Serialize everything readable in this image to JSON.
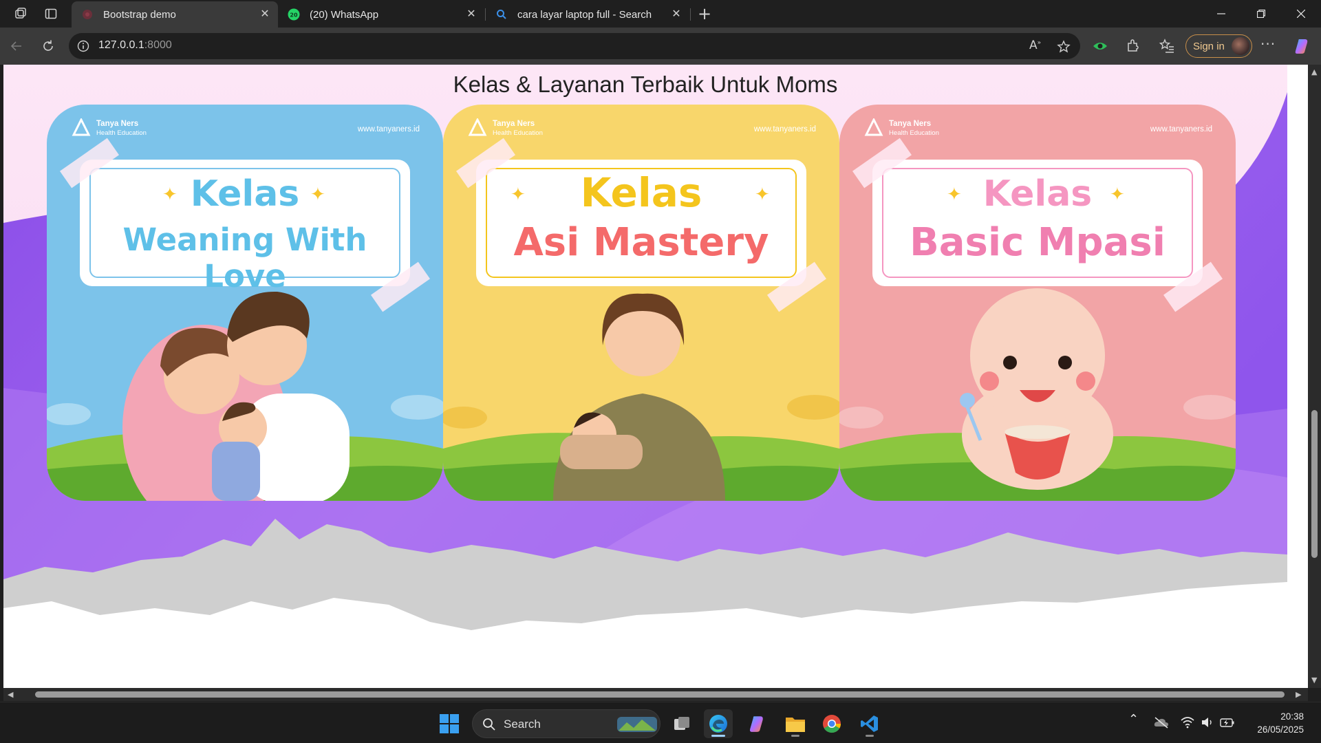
{
  "browser": {
    "tabs": [
      {
        "title": "Bootstrap demo",
        "active": true
      },
      {
        "title": "(20) WhatsApp",
        "badge": "20",
        "active": false
      },
      {
        "title": "cara layar laptop full - Search",
        "active": false
      }
    ],
    "url_host": "127.0.0.1",
    "url_port": ":8000",
    "sign_in_label": "Sign in"
  },
  "page": {
    "heading": "Kelas & Layanan Terbaik Untuk Moms",
    "cards": [
      {
        "brand": "Tanya Ners",
        "brand_sub": "Health Education",
        "site": "www.tanyaners.id",
        "kelas": "Kelas",
        "title": "Weaning With Love",
        "bg": "#7cc3ea",
        "kelas_color": "#5ec0e8",
        "title_color": "#5ec0e8"
      },
      {
        "brand": "Tanya Ners",
        "brand_sub": "Health Education",
        "site": "www.tanyaners.id",
        "kelas": "Kelas",
        "title": "Asi Mastery",
        "bg": "#f8d66b",
        "kelas_color": "#f4c51d",
        "title_color": "#f46a6a"
      },
      {
        "brand": "Tanya Ners",
        "brand_sub": "Health Education",
        "site": "www.tanyaners.id",
        "kelas": "Kelas",
        "title": "Basic Mpasi",
        "bg": "#f2a4a6",
        "kelas_color": "#f596c1",
        "title_color": "#f07fb0"
      }
    ]
  },
  "taskbar": {
    "search_label": "Search",
    "time": "20:38",
    "date": "26/05/2025"
  },
  "colors": {
    "purple_wave": "#9b5be8",
    "grey_wave": "#cfcfcf",
    "page_top": "#fde6f6"
  }
}
